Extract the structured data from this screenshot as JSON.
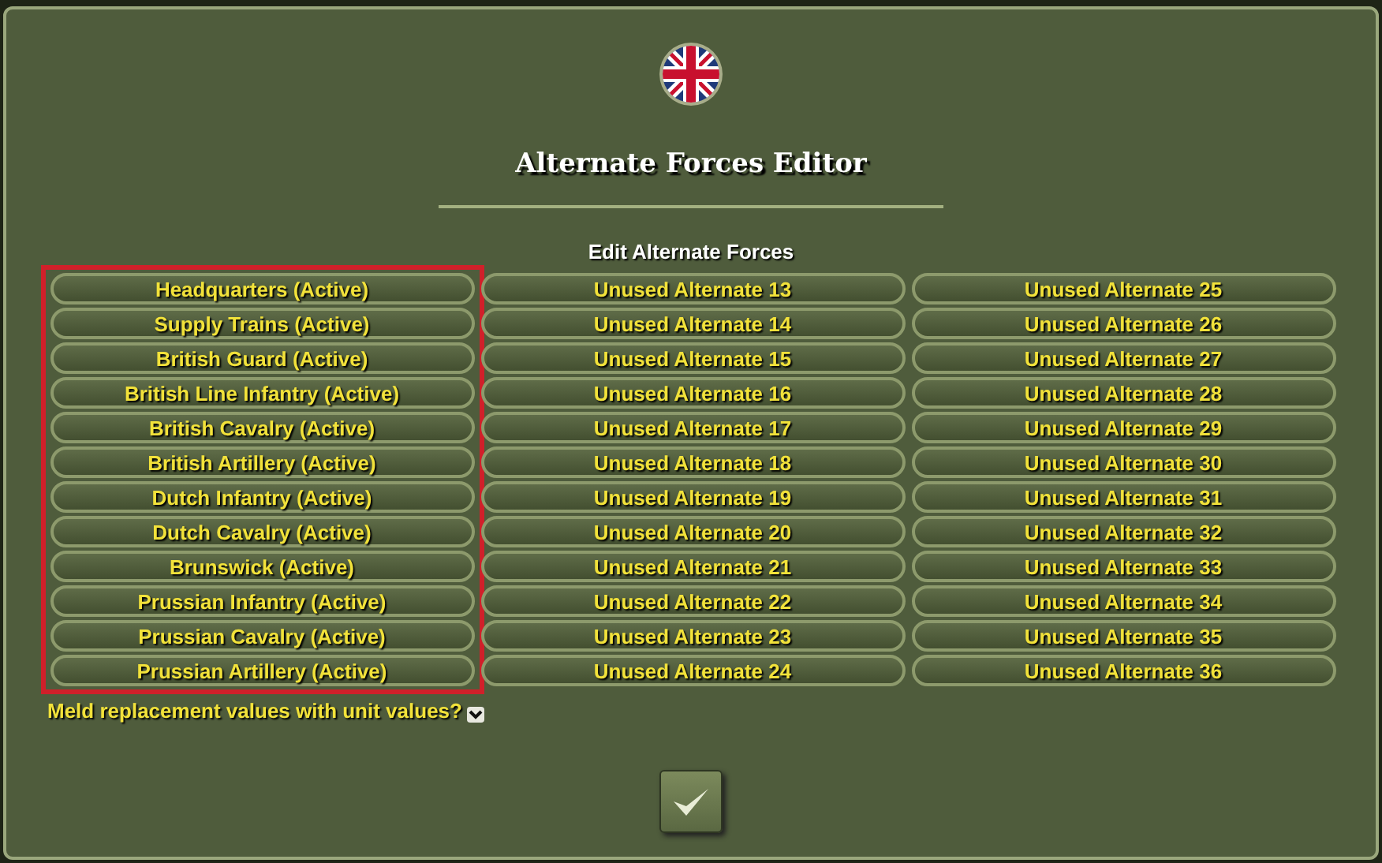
{
  "dialog": {
    "title": "Alternate Forces Editor",
    "subtitle": "Edit Alternate Forces"
  },
  "columns": [
    {
      "highlighted": true,
      "items": [
        "Headquarters (Active)",
        "Supply Trains (Active)",
        "British Guard (Active)",
        "British Line Infantry (Active)",
        "British Cavalry (Active)",
        "British Artillery (Active)",
        "Dutch Infantry (Active)",
        "Dutch Cavalry (Active)",
        "Brunswick (Active)",
        "Prussian Infantry (Active)",
        "Prussian Cavalry (Active)",
        "Prussian Artillery (Active)"
      ]
    },
    {
      "highlighted": false,
      "items": [
        "Unused Alternate 13",
        "Unused Alternate 14",
        "Unused Alternate 15",
        "Unused Alternate 16",
        "Unused Alternate 17",
        "Unused Alternate 18",
        "Unused Alternate 19",
        "Unused Alternate 20",
        "Unused Alternate 21",
        "Unused Alternate 22",
        "Unused Alternate 23",
        "Unused Alternate 24"
      ]
    },
    {
      "highlighted": false,
      "items": [
        "Unused Alternate 25",
        "Unused Alternate 26",
        "Unused Alternate 27",
        "Unused Alternate 28",
        "Unused Alternate 29",
        "Unused Alternate 30",
        "Unused Alternate 31",
        "Unused Alternate 32",
        "Unused Alternate 33",
        "Unused Alternate 34",
        "Unused Alternate 35",
        "Unused Alternate 36"
      ]
    }
  ],
  "meld": {
    "label": "Meld replacement values with unit values?",
    "checked": true
  }
}
